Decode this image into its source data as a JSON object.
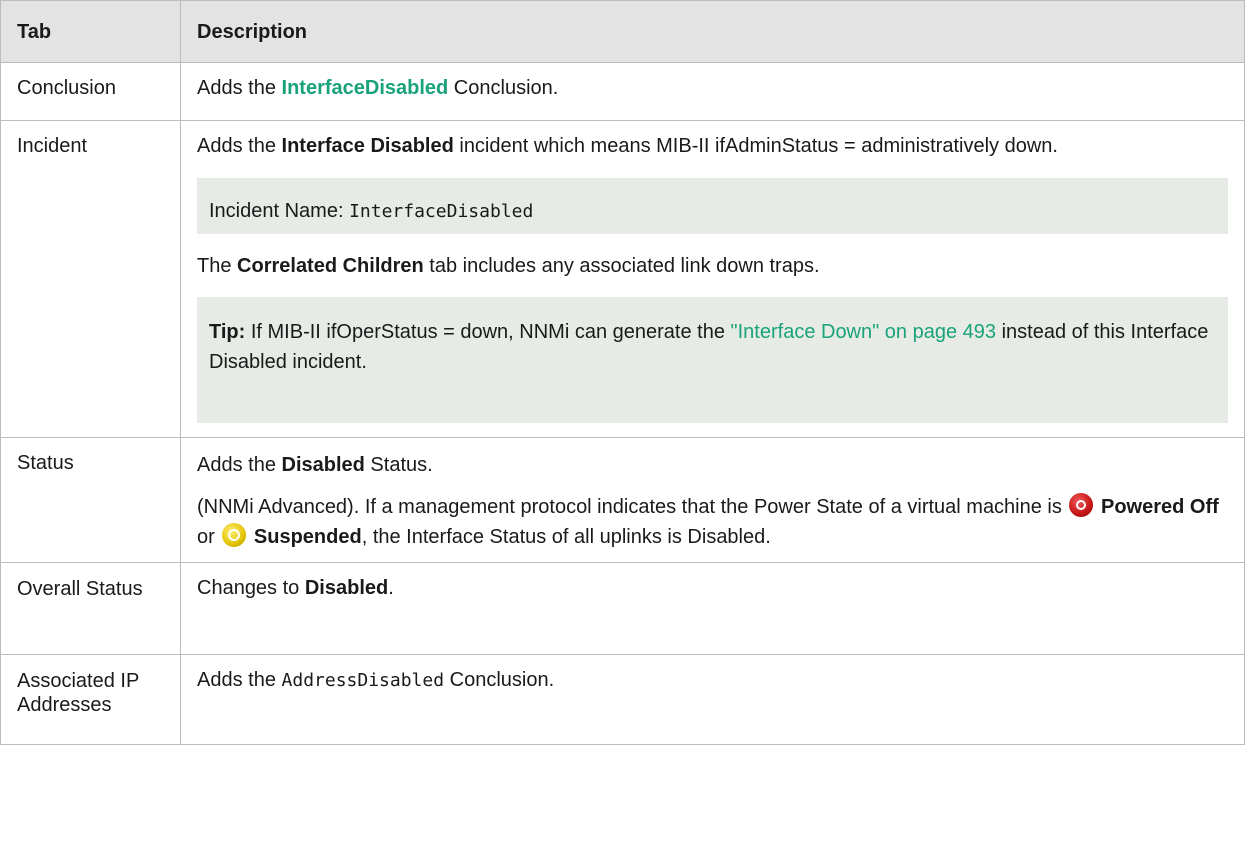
{
  "header": {
    "tab": "Tab",
    "description": "Description"
  },
  "rows": {
    "conclusion": {
      "tab": "Conclusion",
      "pre": "Adds the ",
      "link": "InterfaceDisabled",
      "post": " Conclusion."
    },
    "incident": {
      "tab": "Incident",
      "pre": "Adds the ",
      "bold": "Interface Disabled",
      "post": " incident which means MIB-II ifAdminStatus = administratively down.",
      "code_label": "Incident Name: ",
      "code_value": "InterfaceDisabled",
      "corr_pre": "The ",
      "corr_bold": "Correlated Children",
      "corr_post": " tab includes any associated link down traps.",
      "tip_label": "Tip:",
      "tip_pre": " If MIB-II ifOperStatus = down, NNMi can generate the ",
      "tip_link": "\"Interface Down\" on page 493",
      "tip_post": " instead of this Interface Disabled incident."
    },
    "status": {
      "tab": "Status",
      "pre": "Adds the ",
      "bold": "Disabled",
      "post": " Status.",
      "adv_text": "(NNMi Advanced). If a management protocol indicates that the Power State of a virtual machine is ",
      "powered_off": "Powered Off",
      "or_text": " or ",
      "suspended": "Suspended",
      "adv_post": ", the Interface Status of all uplinks is Disabled.",
      "icons": {
        "powered_off": "powered-off-icon",
        "suspended": "suspended-icon"
      }
    },
    "overall": {
      "tab": "Overall Status",
      "pre": "Changes to ",
      "bold": "Disabled",
      "post": "."
    },
    "assoc": {
      "tab": "Associated IP Addresses",
      "pre": "Adds the ",
      "code": "AddressDisabled",
      "post": " Conclusion."
    }
  },
  "colors": {
    "link": "#1aa37a",
    "header_bg": "#e3e3e3",
    "box_bg": "#e6ebe6",
    "border": "#bcbcbc"
  }
}
